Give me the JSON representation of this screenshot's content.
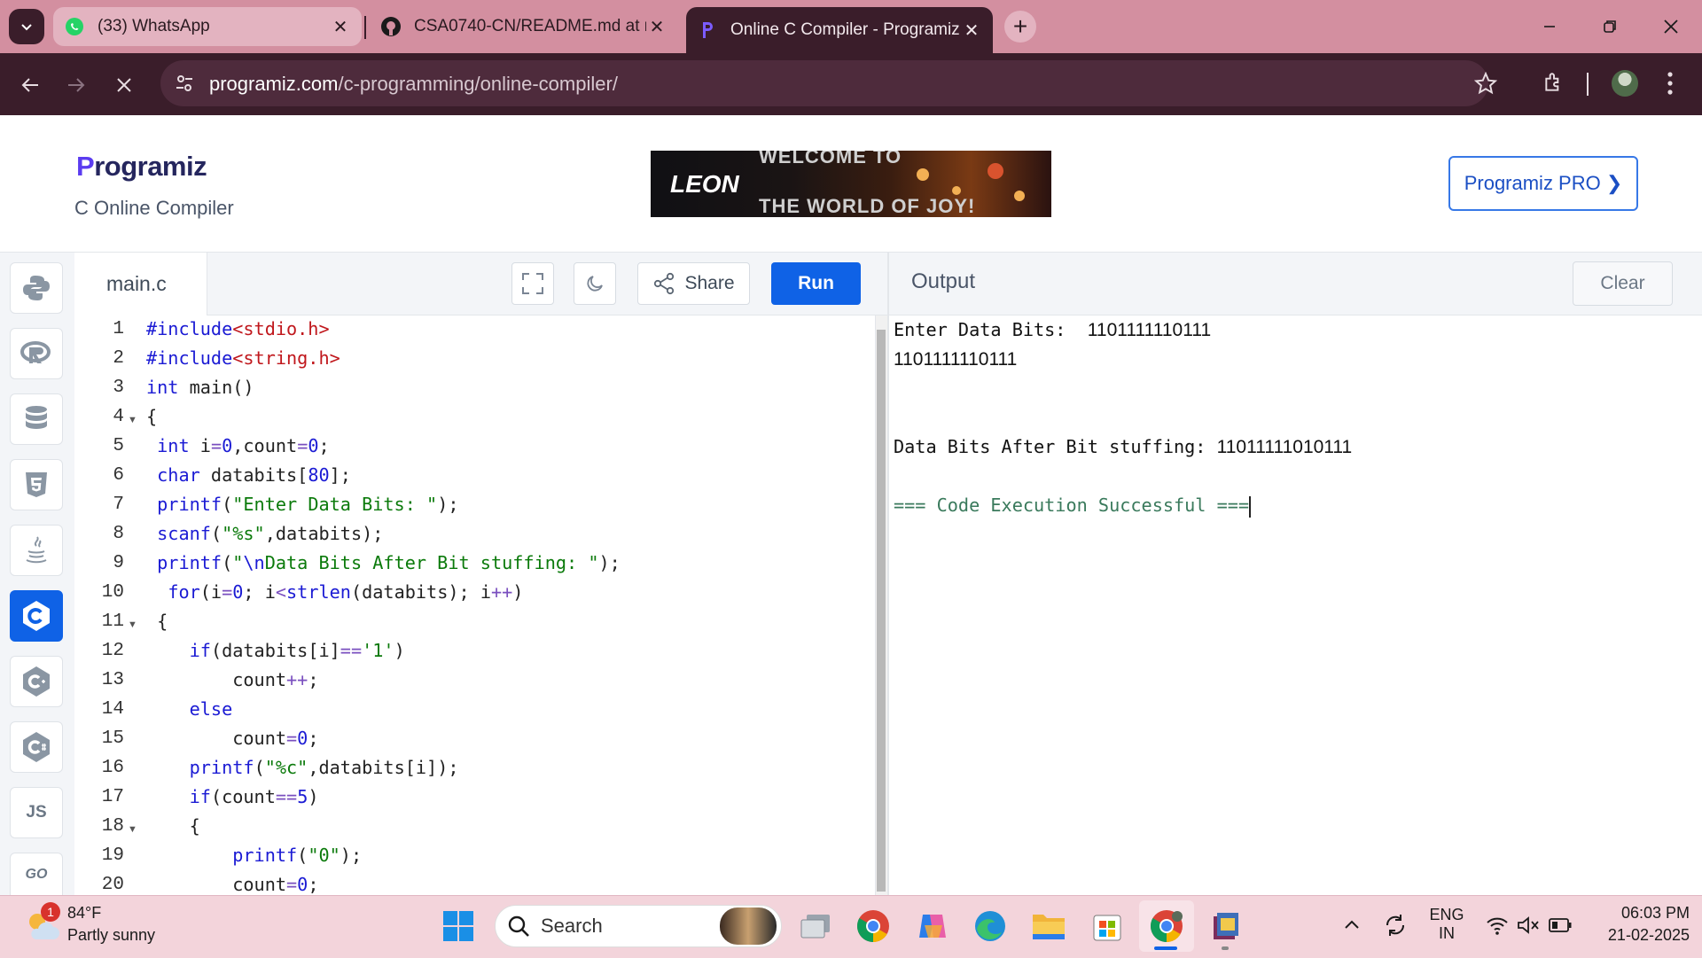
{
  "browser": {
    "tabs": [
      {
        "title": "(33) WhatsApp",
        "active": false,
        "icon": "whatsapp-icon"
      },
      {
        "title": "CSA0740-CN/README.md at m",
        "active": false,
        "icon": "github-icon"
      },
      {
        "title": "Online C Compiler - Programiz",
        "active": true,
        "icon": "programiz-icon"
      }
    ],
    "url_domain": "programiz.com",
    "url_path": "/c-programming/online-compiler/"
  },
  "site": {
    "logo_initial": "P",
    "logo_rest": "rogramiz",
    "subtitle": "C Online Compiler",
    "banner_brand": "LEON",
    "banner_line1": "WELCOME TO",
    "banner_line2": "THE WORLD OF JOY!",
    "pro_button": "Programiz PRO ❯"
  },
  "languages": [
    {
      "name": "python",
      "active": false
    },
    {
      "name": "r",
      "active": false
    },
    {
      "name": "sql",
      "active": false
    },
    {
      "name": "html",
      "active": false
    },
    {
      "name": "java",
      "active": false
    },
    {
      "name": "c",
      "active": true
    },
    {
      "name": "cpp",
      "active": false
    },
    {
      "name": "csharp",
      "active": false
    },
    {
      "name": "js",
      "label": "JS",
      "active": false
    },
    {
      "name": "go",
      "label": "GO",
      "active": false
    }
  ],
  "editor": {
    "filename": "main.c",
    "share_label": "Share",
    "run_label": "Run",
    "line_numbers": [
      "1",
      "2",
      "3",
      "4",
      "5",
      "6",
      "7",
      "8",
      "9",
      "10",
      "11",
      "12",
      "13",
      "14",
      "15",
      "16",
      "17",
      "18",
      "19",
      "20"
    ]
  },
  "output": {
    "title": "Output",
    "clear_label": "Clear",
    "line1_label": "Enter Data Bits:  ",
    "line1_value": "1101111110111",
    "line2": "1101111110111",
    "line3_label": "Data Bits After Bit stuffing: ",
    "line3_value": "11011111010111",
    "status": "=== Code Execution Successful ==="
  },
  "taskbar": {
    "weather_temp": "84°F",
    "weather_desc": "Partly sunny",
    "weather_badge": "1",
    "search_placeholder": "Search",
    "lang_line1": "ENG",
    "lang_line2": "IN",
    "time": "06:03 PM",
    "date": "21-02-2025"
  }
}
